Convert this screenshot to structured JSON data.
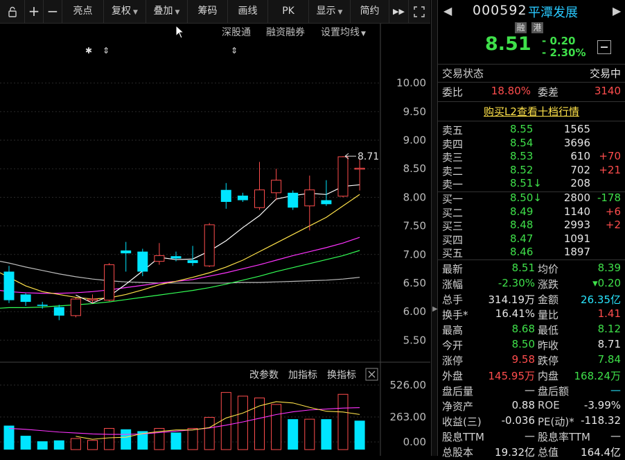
{
  "toolbar": {
    "items": [
      "亮点",
      "复权",
      "叠加",
      "筹码",
      "画线",
      "PK",
      "显示",
      "简约"
    ],
    "sub_items": [
      "深股通",
      "融资融券",
      "设置均线"
    ],
    "indicator_tools": [
      "改参数",
      "加指标",
      "换指标"
    ]
  },
  "chart": {
    "price_ticks": [
      "10.00",
      "9.50",
      "9.00",
      "8.50",
      "8.00",
      "7.50",
      "7.00",
      "6.50",
      "6.00",
      "5.50"
    ],
    "high_marker": "8.71",
    "volume_ticks": [
      "526.00",
      "263.00",
      "0.00"
    ],
    "colors": {
      "up": "#ff4d4d",
      "down": "#00e5ff",
      "ma5": "#ffffff",
      "ma10": "#ffe24a",
      "ma20": "#ff33ff",
      "ma60": "#33ff55",
      "ma120": "#bdbdbd"
    }
  },
  "chart_data": {
    "type": "candlestick",
    "ylim": [
      5.2,
      10.3
    ],
    "candles": [
      {
        "o": 6.7,
        "h": 6.8,
        "c": 6.2,
        "l": 6.15
      },
      {
        "o": 6.3,
        "h": 6.32,
        "c": 6.17,
        "l": 6.1
      },
      {
        "o": 6.12,
        "h": 6.17,
        "c": 6.1,
        "l": 6.05
      },
      {
        "o": 6.08,
        "h": 6.12,
        "c": 5.93,
        "l": 5.85
      },
      {
        "o": 5.93,
        "h": 6.25,
        "c": 6.22,
        "l": 5.9
      },
      {
        "o": 6.2,
        "h": 6.3,
        "c": 6.22,
        "l": 6.15
      },
      {
        "o": 6.2,
        "h": 6.85,
        "c": 6.82,
        "l": 6.18
      },
      {
        "o": 7.07,
        "h": 7.22,
        "c": 7.02,
        "l": 6.7
      },
      {
        "o": 7.05,
        "h": 7.1,
        "c": 6.7,
        "l": 6.62
      },
      {
        "o": 6.88,
        "h": 7.2,
        "c": 6.98,
        "l": 6.82
      },
      {
        "o": 6.97,
        "h": 7.05,
        "c": 6.93,
        "l": 6.88
      },
      {
        "o": 6.9,
        "h": 7.15,
        "c": 6.85,
        "l": 6.8
      },
      {
        "o": 6.8,
        "h": 7.55,
        "c": 7.52,
        "l": 6.78
      },
      {
        "o": 8.13,
        "h": 8.25,
        "c": 7.92,
        "l": 7.8
      },
      {
        "o": 8.03,
        "h": 8.08,
        "c": 7.95,
        "l": 7.92
      },
      {
        "o": 7.82,
        "h": 8.62,
        "c": 8.13,
        "l": 7.78
      },
      {
        "o": 8.08,
        "h": 8.5,
        "c": 8.3,
        "l": 7.95
      },
      {
        "o": 8.08,
        "h": 8.12,
        "c": 7.82,
        "l": 7.78
      },
      {
        "o": 7.85,
        "h": 8.38,
        "c": 8.13,
        "l": 7.42
      },
      {
        "o": 7.95,
        "h": 8.3,
        "c": 7.88,
        "l": 7.85
      },
      {
        "o": 8.02,
        "h": 8.72,
        "c": 8.71,
        "l": 8.0
      },
      {
        "o": 8.5,
        "h": 8.68,
        "c": 8.51,
        "l": 8.12
      }
    ],
    "ma5": [
      null,
      null,
      null,
      null,
      6.29,
      6.15,
      6.27,
      6.48,
      6.71,
      6.95,
      6.91,
      6.92,
      7.06,
      7.24,
      7.47,
      7.68,
      7.97,
      8.03,
      8.07,
      8.05,
      8.19,
      8.22
    ],
    "ma10": [
      6.6,
      6.45,
      6.35,
      6.3,
      6.25,
      6.22,
      6.24,
      6.3,
      6.38,
      6.47,
      6.53,
      6.6,
      6.68,
      6.78,
      6.9,
      7.05,
      7.2,
      7.35,
      7.5,
      7.65,
      7.85,
      8.05
    ],
    "ma20": [
      6.35,
      6.33,
      6.32,
      6.32,
      6.33,
      6.35,
      6.38,
      6.42,
      6.46,
      6.5,
      6.53,
      6.56,
      6.62,
      6.68,
      6.75,
      6.82,
      6.9,
      6.98,
      7.05,
      7.12,
      7.2,
      7.3
    ],
    "ma60": [
      6.07,
      6.07,
      6.08,
      6.1,
      6.12,
      6.14,
      6.17,
      6.21,
      6.25,
      6.29,
      6.33,
      6.37,
      6.42,
      6.48,
      6.55,
      6.62,
      6.7,
      6.77,
      6.84,
      6.91,
      6.98,
      7.07
    ],
    "ma120": [
      6.85,
      6.78,
      6.72,
      6.66,
      6.61,
      6.57,
      6.54,
      6.52,
      6.51,
      6.5,
      6.5,
      6.5,
      6.5,
      6.5,
      6.51,
      6.51,
      6.52,
      6.53,
      6.54,
      6.55,
      6.57,
      6.6
    ],
    "volume_ylim": [
      0,
      700
    ],
    "volume": [
      {
        "v": 260,
        "up": false
      },
      {
        "v": 150,
        "up": false
      },
      {
        "v": 90,
        "up": false
      },
      {
        "v": 100,
        "up": false
      },
      {
        "v": 120,
        "up": true
      },
      {
        "v": 100,
        "up": true
      },
      {
        "v": 230,
        "up": true
      },
      {
        "v": 220,
        "up": false
      },
      {
        "v": 200,
        "up": false
      },
      {
        "v": 230,
        "up": true
      },
      {
        "v": 185,
        "up": false
      },
      {
        "v": 230,
        "up": true
      },
      {
        "v": 350,
        "up": true
      },
      {
        "v": 620,
        "up": true
      },
      {
        "v": 580,
        "up": true
      },
      {
        "v": 560,
        "up": true
      },
      {
        "v": 490,
        "up": true
      },
      {
        "v": 330,
        "up": false
      },
      {
        "v": 330,
        "up": true
      },
      {
        "v": 330,
        "up": false
      },
      {
        "v": 600,
        "up": true
      },
      {
        "v": 314,
        "up": false
      }
    ],
    "vol_ma5": [
      null,
      null,
      null,
      null,
      144,
      112,
      128,
      134,
      174,
      196,
      213,
      213,
      239,
      343,
      396,
      474,
      520,
      506,
      458,
      416,
      408,
      381
    ],
    "vol_ma10": [
      230,
      220,
      205,
      190,
      180,
      170,
      165,
      165,
      170,
      185,
      200,
      215,
      235,
      265,
      300,
      340,
      380,
      410,
      430,
      440,
      450,
      455
    ]
  },
  "quote": {
    "code": "000592",
    "name": "平潭发展",
    "tags": [
      "融",
      "港"
    ],
    "price": "8.51",
    "change": "- 0.20",
    "change_pct": "- 2.30%",
    "status_label": "交易状态",
    "status_value": "交易中",
    "weibi_label": "委比",
    "weibi_value": "18.80%",
    "weicha_label": "委差",
    "weicha_value": "3140",
    "l2_link": "购买L2查看十档行情",
    "asks": [
      {
        "label": "卖五",
        "price": "8.55",
        "vol": "1565",
        "chg": ""
      },
      {
        "label": "卖四",
        "price": "8.54",
        "vol": "3696",
        "chg": ""
      },
      {
        "label": "卖三",
        "price": "8.53",
        "vol": "610",
        "chg": "+70"
      },
      {
        "label": "卖二",
        "price": "8.52",
        "vol": "702",
        "chg": "+21"
      },
      {
        "label": "卖一",
        "price": "8.51↓",
        "vol": "208",
        "chg": ""
      }
    ],
    "bids": [
      {
        "label": "买一",
        "price": "8.50↓",
        "vol": "2800",
        "chg": "-178"
      },
      {
        "label": "买二",
        "price": "8.49",
        "vol": "1140",
        "chg": "+6"
      },
      {
        "label": "买三",
        "price": "8.48",
        "vol": "2993",
        "chg": "+2"
      },
      {
        "label": "买四",
        "price": "8.47",
        "vol": "1091",
        "chg": ""
      },
      {
        "label": "买五",
        "price": "8.46",
        "vol": "1897",
        "chg": ""
      }
    ],
    "stats": [
      {
        "l1": "最新",
        "v1": "8.51",
        "c1": "green",
        "l2": "均价",
        "v2": "8.39",
        "c2": "green"
      },
      {
        "l1": "涨幅",
        "v1": "-2.30%",
        "c1": "green",
        "l2": "涨跌",
        "v2": "▾0.20",
        "c2": "green"
      },
      {
        "l1": "总手",
        "v1": "314.19万",
        "c1": "white",
        "l2": "金额",
        "v2": "26.35亿",
        "c2": "cyan"
      },
      {
        "l1": "换手*",
        "v1": "16.41%",
        "c1": "white",
        "l2": "量比",
        "v2": "1.41",
        "c2": "red"
      },
      {
        "l1": "最高",
        "v1": "8.68",
        "c1": "green",
        "l2": "最低",
        "v2": "8.12",
        "c2": "green"
      },
      {
        "l1": "今开",
        "v1": "8.50",
        "c1": "green",
        "l2": "昨收",
        "v2": "8.71",
        "c2": "white"
      },
      {
        "l1": "涨停",
        "v1": "9.58",
        "c1": "red",
        "l2": "跌停",
        "v2": "7.84",
        "c2": "green"
      },
      {
        "l1": "外盘",
        "v1": "145.95万",
        "c1": "red",
        "l2": "内盘",
        "v2": "168.24万",
        "c2": "green"
      },
      {
        "l1": "盘后量",
        "v1": "—",
        "c1": "white",
        "l2": "盘后额",
        "v2": "—",
        "c2": "cyan"
      },
      {
        "l1": "净资产",
        "v1": "0.88",
        "c1": "white",
        "l2": "ROE",
        "v2": "-3.99%",
        "c2": "white"
      },
      {
        "l1": "收益(三)",
        "v1": "-0.036",
        "c1": "white",
        "l2": "PE(动)*",
        "v2": "-118.32",
        "c2": "white"
      },
      {
        "l1": "股息TTM",
        "v1": "—",
        "c1": "white",
        "l2": "股息率TTM",
        "v2": "—",
        "c2": "white"
      },
      {
        "l1": "总股本",
        "v1": "19.32亿",
        "c1": "white",
        "l2": "总值",
        "v2": "164.4亿",
        "c2": "white"
      }
    ]
  }
}
